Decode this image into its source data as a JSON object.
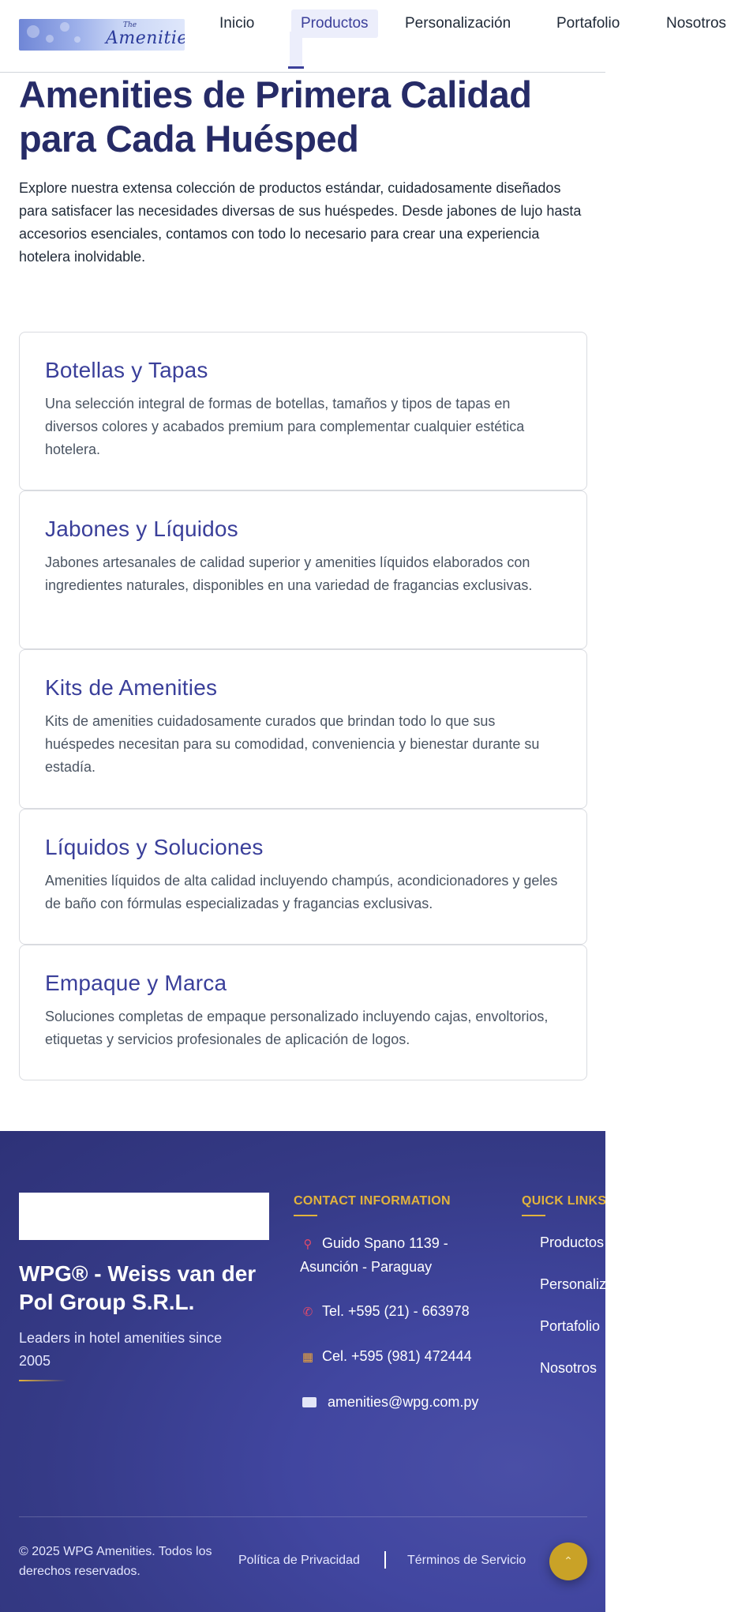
{
  "header": {
    "logo": {
      "small_text": "The",
      "text": "Amenities"
    },
    "nav": [
      {
        "label": "Inicio"
      },
      {
        "label": "Productos",
        "active": true
      },
      {
        "label": "Personalización"
      },
      {
        "label": "Portafolio"
      },
      {
        "label": "Nosotros"
      }
    ]
  },
  "hero": {
    "title": "Amenities de Primera Calidad para Cada Huésped",
    "description": "Explore nuestra extensa colección de productos estándar, cuidadosamente diseñados para satisfacer las necesidades diversas de sus huéspedes. Desde jabones de lujo hasta accesorios esenciales, contamos con todo lo necesario para crear una experiencia hotelera inolvidable."
  },
  "categories": [
    {
      "title": "Botellas y Tapas",
      "description": "Una selección integral de formas de botellas, tamaños y tipos de tapas en diversos colores y acabados premium para complementar cualquier estética hotelera."
    },
    {
      "title": "Jabones y Líquidos",
      "description": "Jabones artesanales de calidad superior y amenities líquidos elaborados con ingredientes naturales, disponibles en una variedad de fragancias exclusivas."
    },
    {
      "title": "Kits de Amenities",
      "description": "Kits de amenities cuidadosamente curados que brindan todo lo que sus huéspedes necesitan para su comodidad, conveniencia y bienestar durante su estadía."
    },
    {
      "title": "Líquidos y Soluciones",
      "description": "Amenities líquidos de alta calidad incluyendo champús, acondicionadores y geles de baño con fórmulas especializadas y fragancias exclusivas."
    },
    {
      "title": "Empaque y Marca",
      "description": "Soluciones completas de empaque personalizado incluyendo cajas, envoltorios, etiquetas y servicios profesionales de aplicación de logos."
    }
  ],
  "footer": {
    "company_name": "WPG® - Weiss van der Pol Group S.R.L.",
    "tagline": "Leaders in hotel amenities since 2005",
    "contact_heading": "CONTACT INFORMATION",
    "contact": {
      "address": "Guido Spano 1139 - Asunción - Paraguay",
      "phone": "Tel. +595 (21) - 663978",
      "mobile": "Cel. +595 (981) 472444",
      "email": "amenities@wpg.com.py"
    },
    "quick_links_heading": "QUICK LINKS",
    "quick_links": [
      "Productos",
      "Personalización",
      "Portafolio",
      "Nosotros"
    ],
    "copyright": "© 2025 WPG Amenities. Todos los derechos reservados.",
    "privacy_label": "Política de Privacidad",
    "terms_label": "Términos de Servicio",
    "back_to_top_icon": "chevron-up-icon"
  },
  "colors": {
    "brand_navy": "#262b67",
    "accent_indigo": "#3a3f9a",
    "gold": "#e2b33c",
    "footer_bg": "#383d8c"
  }
}
